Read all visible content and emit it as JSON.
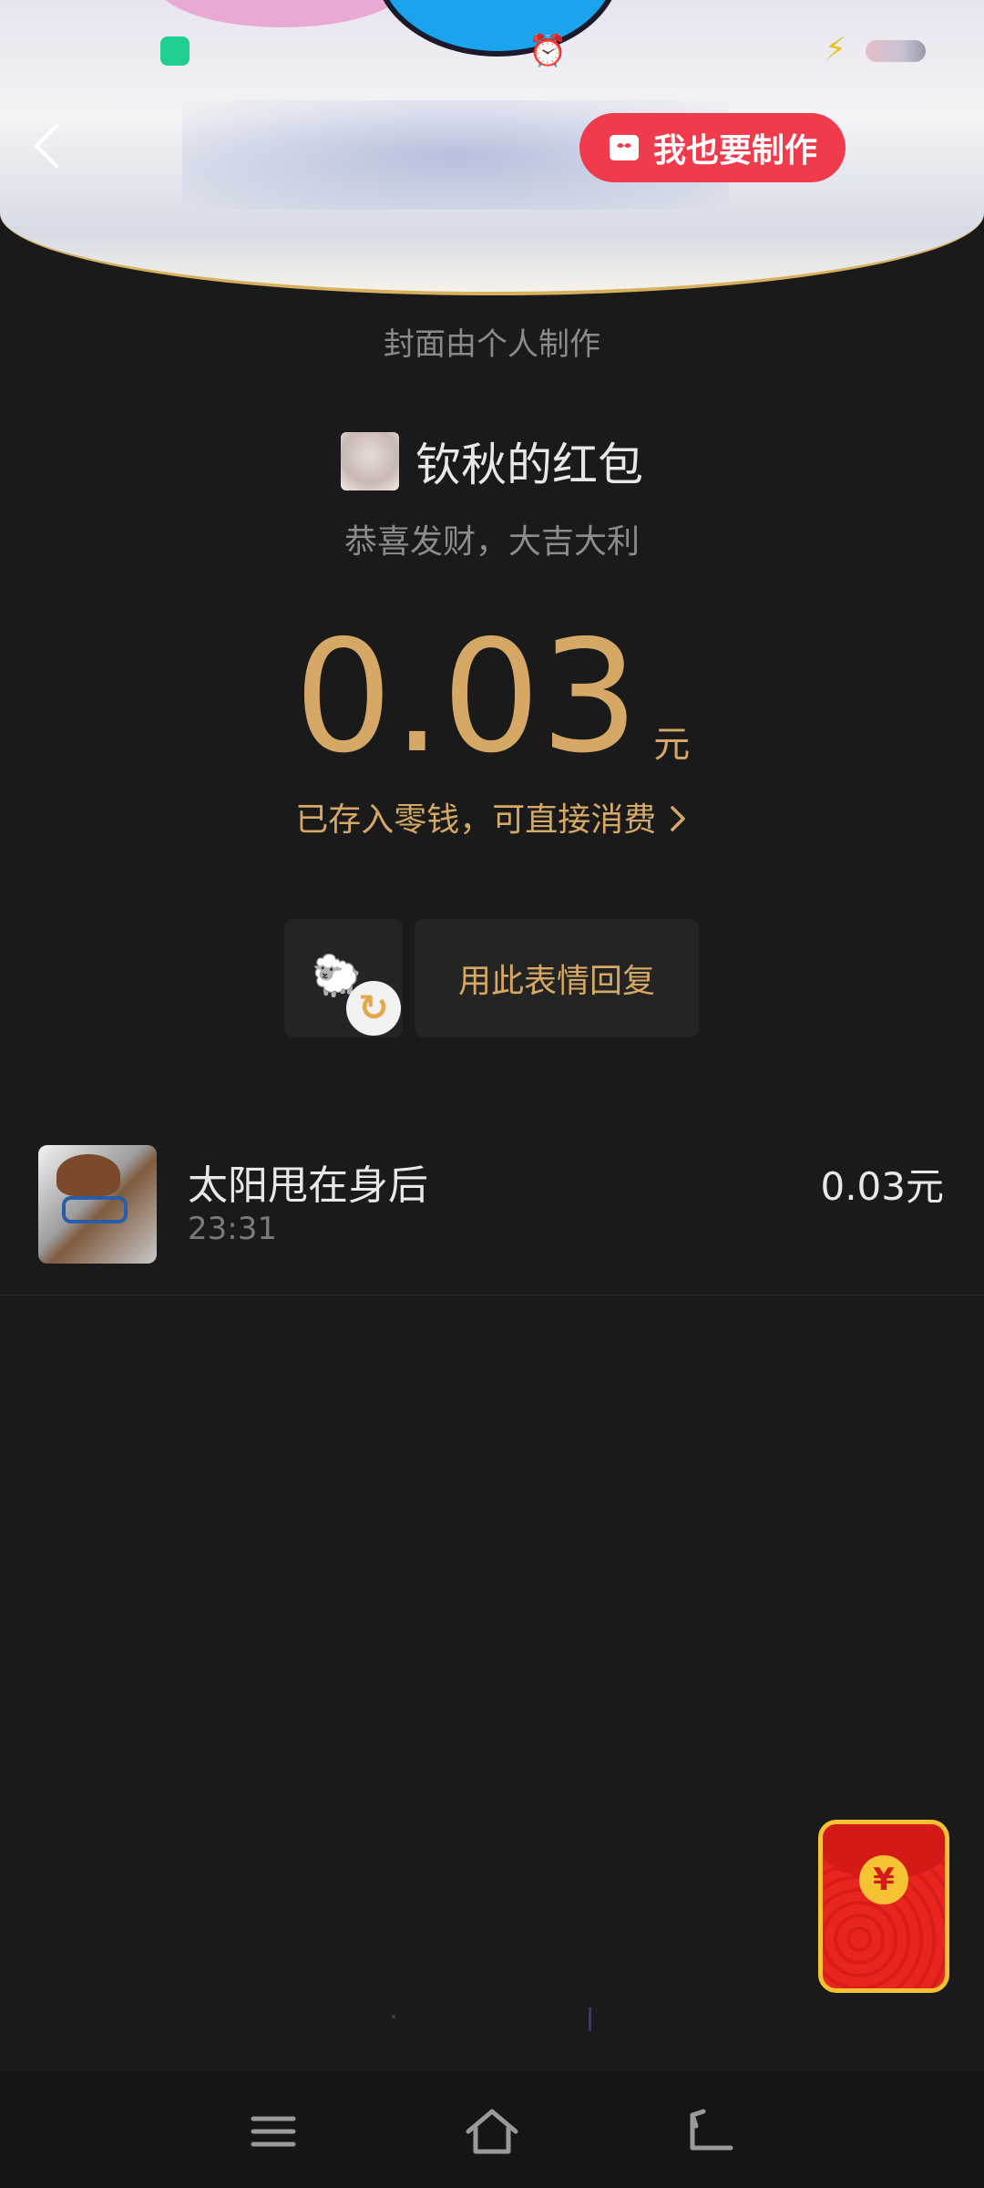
{
  "status_bar": {
    "shield_icon": "shield-icon",
    "alarm_icon": "alarm-icon",
    "charging_icon": "lightning-icon"
  },
  "header": {
    "back_icon": "back-chevron-icon",
    "make_button_label": "我也要制作",
    "make_button_icon": "gift-box-icon",
    "accent_color": "#f03b4c"
  },
  "cover_note": "封面由个人制作",
  "packet": {
    "sender_name": "钦秋的红包",
    "wish": "恭喜发财，大吉大利",
    "amount": "0.03",
    "unit": "元",
    "stored_link": "已存入零钱，可直接消费",
    "amount_color": "#d6a865"
  },
  "reply": {
    "refresh_icon": "refresh-icon",
    "reply_label": "用此表情回复"
  },
  "records": [
    {
      "name": "太阳甩在身后",
      "time": "23:31",
      "amount": "0.03元"
    }
  ],
  "floating": {
    "envelope_symbol": "¥"
  },
  "navbar": {
    "menu_icon": "menu-icon",
    "home_icon": "home-icon",
    "back_icon": "return-icon"
  }
}
